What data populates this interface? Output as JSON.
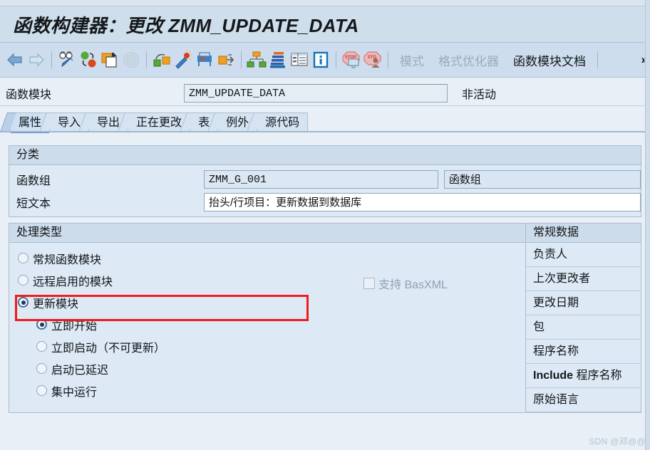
{
  "window": {
    "title_cn": "函数构建器：更改 ",
    "title_obj": "ZMM_UPDATE_DATA"
  },
  "toolbar": {
    "icons": [
      {
        "name": "back-arrow-icon",
        "label": "后退"
      },
      {
        "name": "forward-arrow-icon",
        "label": "前进"
      },
      {
        "name": "display-change-icon",
        "label": "显示/更改"
      },
      {
        "name": "other-object-icon",
        "label": "其它对象"
      },
      {
        "name": "copy-object-icon",
        "label": "复制"
      },
      {
        "name": "where-used-icon",
        "label": "使用位置列表"
      },
      {
        "name": "navigation-icon",
        "label": "导航"
      },
      {
        "name": "pattern-icon",
        "label": "模式"
      },
      {
        "name": "print-preview-icon",
        "label": "打印预览"
      },
      {
        "name": "activate-icon",
        "label": "激活"
      },
      {
        "name": "hierarchy-icon",
        "label": "对象目录"
      },
      {
        "name": "stack-icon",
        "label": "堆栈"
      },
      {
        "name": "list-icon",
        "label": "列表"
      },
      {
        "name": "info-icon",
        "label": "信息"
      },
      {
        "name": "stop-screen-icon",
        "label": "断点"
      },
      {
        "name": "stop-user-icon",
        "label": "用户断点"
      }
    ],
    "text_buttons": [
      {
        "name": "tb-pattern",
        "label": "模式",
        "enabled": false
      },
      {
        "name": "tb-pretty-printer",
        "label": "格式优化器",
        "enabled": false
      },
      {
        "name": "tb-fm-documentation",
        "label": "函数模块文档",
        "enabled": true
      }
    ],
    "more_label": "»"
  },
  "function_module": {
    "label": "函数模块",
    "value": "ZMM_UPDATE_DATA",
    "status": "非活动"
  },
  "tabs": [
    {
      "label": "属性",
      "active": true
    },
    {
      "label": "导入",
      "active": false
    },
    {
      "label": "导出",
      "active": false
    },
    {
      "label": "正在更改",
      "active": false
    },
    {
      "label": "表",
      "active": false
    },
    {
      "label": "例外",
      "active": false
    },
    {
      "label": "源代码",
      "active": false
    }
  ],
  "classification": {
    "header": "分类",
    "rows": [
      {
        "label": "函数组",
        "value": "ZMM_G_001",
        "secondary": "函数组"
      },
      {
        "label": "短文本",
        "value": "抬头/行项目：更新数据到数据库"
      }
    ]
  },
  "processing_type": {
    "header": "处理类型",
    "options": [
      {
        "label": "常规函数模块",
        "checked": false,
        "indent": false
      },
      {
        "label": "远程启用的模块",
        "checked": false,
        "indent": false
      },
      {
        "label": "更新模块",
        "checked": true,
        "indent": false,
        "highlighted": true
      },
      {
        "label": "立即开始",
        "checked": true,
        "indent": true
      },
      {
        "label": "立即启动（不可更新）",
        "checked": false,
        "indent": true
      },
      {
        "label": "启动已延迟",
        "checked": false,
        "indent": true
      },
      {
        "label": "集中运行",
        "checked": false,
        "indent": true
      }
    ],
    "checkbox": {
      "label": "支持 BasXML",
      "checked": false,
      "enabled": false
    }
  },
  "general_data": {
    "header": "常规数据",
    "items": [
      {
        "label": "负责人",
        "bold": false
      },
      {
        "label": "上次更改者",
        "bold": false
      },
      {
        "label": "更改日期",
        "bold": false
      },
      {
        "label": "包",
        "bold": false
      },
      {
        "label": "程序名称",
        "bold": false
      },
      {
        "label": "Include 程序名称",
        "bold": true,
        "bold_prefix": "Include",
        "rest": " 程序名称"
      },
      {
        "label": "原始语言",
        "bold": false
      }
    ]
  },
  "watermark": "SDN @邓@@",
  "colors": {
    "accent": "#5b8fc9",
    "highlight_red": "#f01b1b",
    "panel_bg": "#dde9f4",
    "titlebar": "#cfdeeb"
  }
}
